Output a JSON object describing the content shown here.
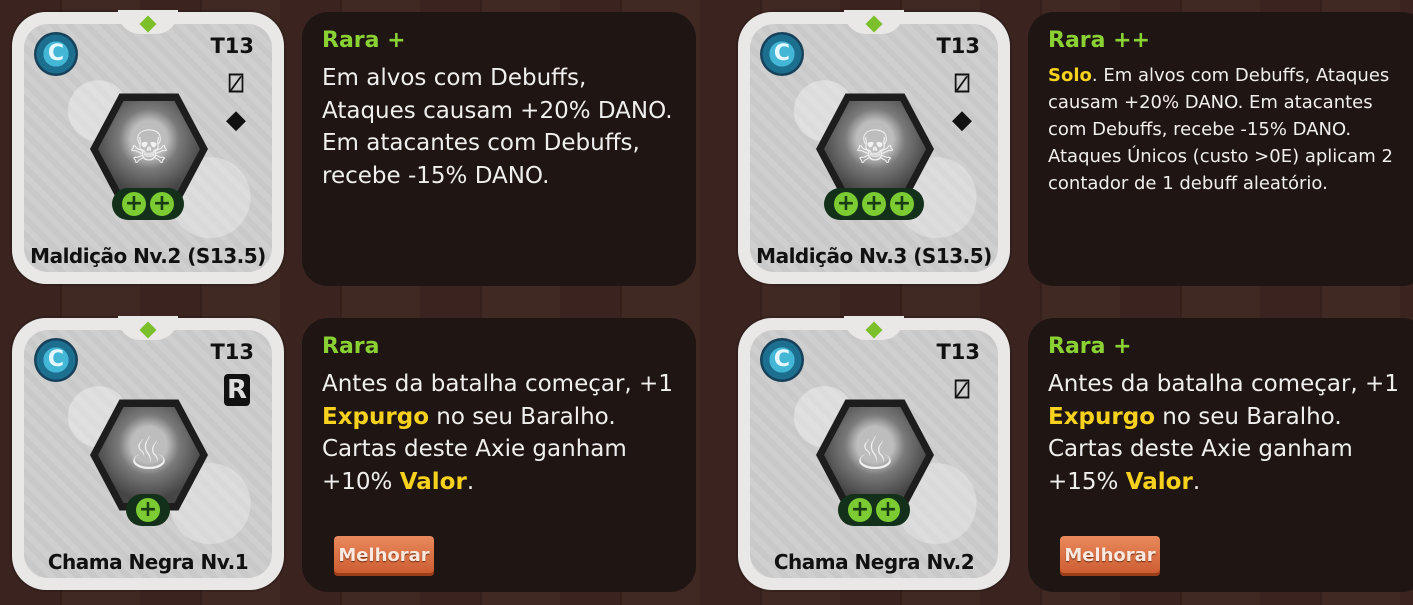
{
  "cards": [
    {
      "tier": "T13",
      "name": "Maldição Nv.2 (S13.5)",
      "type_icon": "no-attack-shield-icon",
      "extra_icon": "gem-icon",
      "pluses": 2,
      "art": "skull-icon",
      "rarity": "Rara +",
      "description": "Em alvos com Debuffs, Ataques causam +20% DANO. Em atacantes com Debuffs, recebe -15% DANO."
    },
    {
      "tier": "T13",
      "name": "Maldição Nv.3 (S13.5)",
      "type_icon": "no-attack-shield-icon",
      "extra_icon": "gem-icon",
      "pluses": 3,
      "art": "skull-icon",
      "rarity": "Rara ++",
      "keyword": "Solo",
      "description": ". Em alvos com Debuffs, Ataques causam +20% DANO. Em atacantes com Debuffs, recebe -15% DANO. Ataques Únicos (custo >0E) aplicam 2 contador de 1 debuff aleatório."
    },
    {
      "tier": "T13",
      "name": "Chama Negra Nv.1",
      "type_icon": "r-badge-icon",
      "pluses": 1,
      "art": "flame-icon",
      "rarity": "Rara",
      "desc_1": "Antes da batalha começar, +1 ",
      "kw_1": "Expurgo",
      "desc_2": " no seu Baralho. Cartas deste Axie ganham +10% ",
      "kw_2": "Valor",
      "desc_3": ".",
      "button": "Melhorar"
    },
    {
      "tier": "T13",
      "name": "Chama Negra Nv.2",
      "type_icon": "no-attack-shield-icon",
      "pluses": 2,
      "art": "flame-icon",
      "rarity": "Rara +",
      "desc_1": "Antes da batalha começar, +1 ",
      "kw_1": "Expurgo",
      "desc_2": " no seu Baralho. Cartas deste Axie ganham +15% ",
      "kw_2": "Valor",
      "desc_3": ".",
      "button": "Melhorar"
    }
  ],
  "class_icon_glyph": "C",
  "plus_glyph": "+",
  "colors": {
    "rarity": "#8ad234",
    "keyword": "#f6d11d",
    "button": "#cb5a2f"
  }
}
